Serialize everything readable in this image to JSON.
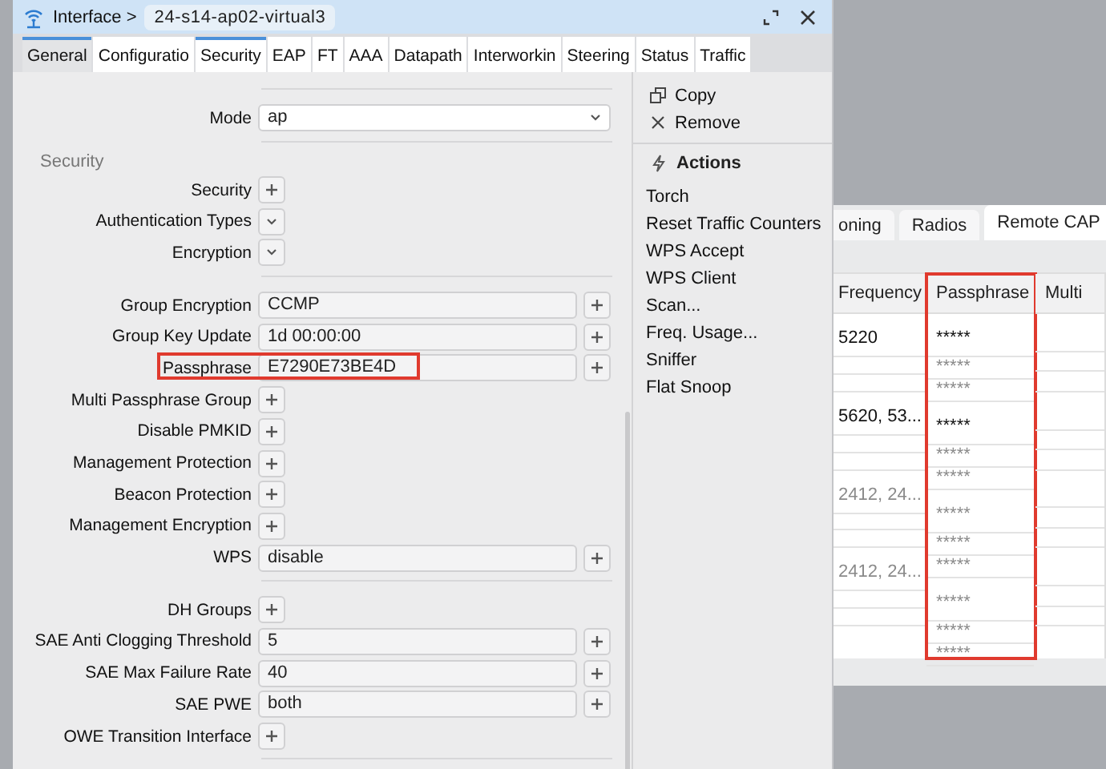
{
  "background_window": {
    "tabs": [
      {
        "label": "oning",
        "selected": false
      },
      {
        "label": "Radios",
        "selected": false
      },
      {
        "label": "Remote CAP",
        "selected": true
      }
    ],
    "table": {
      "columns": [
        {
          "label": "Frequency",
          "highlighted": false
        },
        {
          "label": "Passphrase",
          "highlighted": true
        },
        {
          "label": "Multi",
          "highlighted": false
        }
      ],
      "groups": [
        {
          "rows": [
            {
              "frequency": "5220",
              "passphrase": "*****",
              "dimmed": false
            },
            {
              "passphrase": "*****",
              "dimmed": true
            },
            {
              "passphrase": "*****",
              "dimmed": true
            }
          ]
        },
        {
          "rows": [
            {
              "frequency": "5620, 53...",
              "passphrase": "*****",
              "dimmed": false
            },
            {
              "passphrase": "*****",
              "dimmed": true
            },
            {
              "passphrase": "*****",
              "dimmed": true
            }
          ]
        },
        {
          "rows": [
            {
              "frequency": "2412, 24...",
              "passphrase": "*****",
              "dimmed": true
            },
            {
              "passphrase": "*****",
              "dimmed": true
            },
            {
              "passphrase": "*****",
              "dimmed": true
            }
          ]
        },
        {
          "rows": [
            {
              "frequency": "2412, 24...",
              "passphrase": "*****",
              "dimmed": true
            },
            {
              "passphrase": "*****",
              "dimmed": true
            },
            {
              "passphrase": "*****",
              "dimmed": true
            }
          ]
        }
      ]
    }
  },
  "dialog": {
    "title": "Interface >",
    "breadcrumb": "24-s14-ap02-virtual3",
    "tabs": [
      {
        "label": "General",
        "selected": true,
        "hovered": false
      },
      {
        "label": "Configuratio",
        "selected": false,
        "hovered": false
      },
      {
        "label": "Security",
        "selected": false,
        "hovered": true
      },
      {
        "label": "EAP",
        "selected": false,
        "hovered": false
      },
      {
        "label": "FT",
        "selected": false,
        "hovered": false
      },
      {
        "label": "AAA",
        "selected": false,
        "hovered": false
      },
      {
        "label": "Datapath",
        "selected": false,
        "hovered": false
      },
      {
        "label": "Interworkin",
        "selected": false,
        "hovered": false
      },
      {
        "label": "Steering",
        "selected": false,
        "hovered": false
      },
      {
        "label": "Status",
        "selected": false,
        "hovered": false
      },
      {
        "label": "Traffic",
        "selected": false,
        "hovered": false
      }
    ],
    "form": {
      "sections": [
        {
          "rows": [
            {
              "kind": "select",
              "label": "Mode",
              "value": "ap"
            }
          ]
        },
        {
          "heading": "Security",
          "rows": [
            {
              "kind": "add",
              "label": "Security"
            },
            {
              "kind": "expand",
              "label": "Authentication Types"
            },
            {
              "kind": "expand",
              "label": "Encryption"
            }
          ]
        },
        {
          "rows": [
            {
              "kind": "field",
              "label": "Group Encryption",
              "value": "CCMP"
            },
            {
              "kind": "field",
              "label": "Group Key Update",
              "value": "1d 00:00:00"
            },
            {
              "kind": "field",
              "label": "Passphrase",
              "value": "E7290E73BE4D",
              "highlighted": true
            },
            {
              "kind": "add",
              "label": "Multi Passphrase Group"
            },
            {
              "kind": "add",
              "label": "Disable PMKID"
            },
            {
              "kind": "add",
              "label": "Management Protection"
            },
            {
              "kind": "add",
              "label": "Beacon Protection"
            },
            {
              "kind": "add",
              "label": "Management Encryption"
            },
            {
              "kind": "field",
              "label": "WPS",
              "value": "disable"
            }
          ]
        },
        {
          "rows": [
            {
              "kind": "add",
              "label": "DH Groups"
            },
            {
              "kind": "field",
              "label": "SAE Anti Clogging Threshold",
              "value": "5"
            },
            {
              "kind": "field",
              "label": "SAE Max Failure Rate",
              "value": "40"
            },
            {
              "kind": "field",
              "label": "SAE PWE",
              "value": "both"
            },
            {
              "kind": "add",
              "label": "OWE Transition Interface"
            }
          ]
        }
      ]
    },
    "side_menu": {
      "items": [
        {
          "kind": "copy",
          "label": "Copy"
        },
        {
          "kind": "remove",
          "label": "Remove"
        }
      ],
      "actions_heading": "Actions",
      "actions": [
        "Torch",
        "Reset Traffic Counters",
        "WPS Accept",
        "WPS Client",
        "Scan...",
        "Freq. Usage...",
        "Sniffer",
        "Flat Snoop"
      ]
    }
  }
}
